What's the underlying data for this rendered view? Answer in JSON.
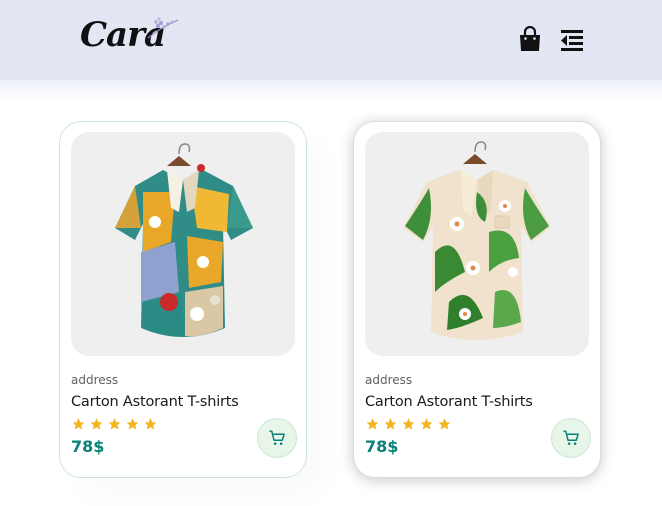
{
  "header": {
    "logo_text": "Cara",
    "icons": [
      "shopping-bag-icon",
      "menu-indent-icon"
    ]
  },
  "colors": {
    "header_bg": "#e3e6f3",
    "accent": "#088178",
    "star": "#f3b519",
    "cart_bg": "#e8f6ea"
  },
  "products": [
    {
      "brand": "address",
      "title": "Carton Astorant T-shirts",
      "rating": 5,
      "price": "78$"
    },
    {
      "brand": "address",
      "title": "Carton Astorant T-shirts",
      "rating": 5,
      "price": "78$"
    }
  ]
}
